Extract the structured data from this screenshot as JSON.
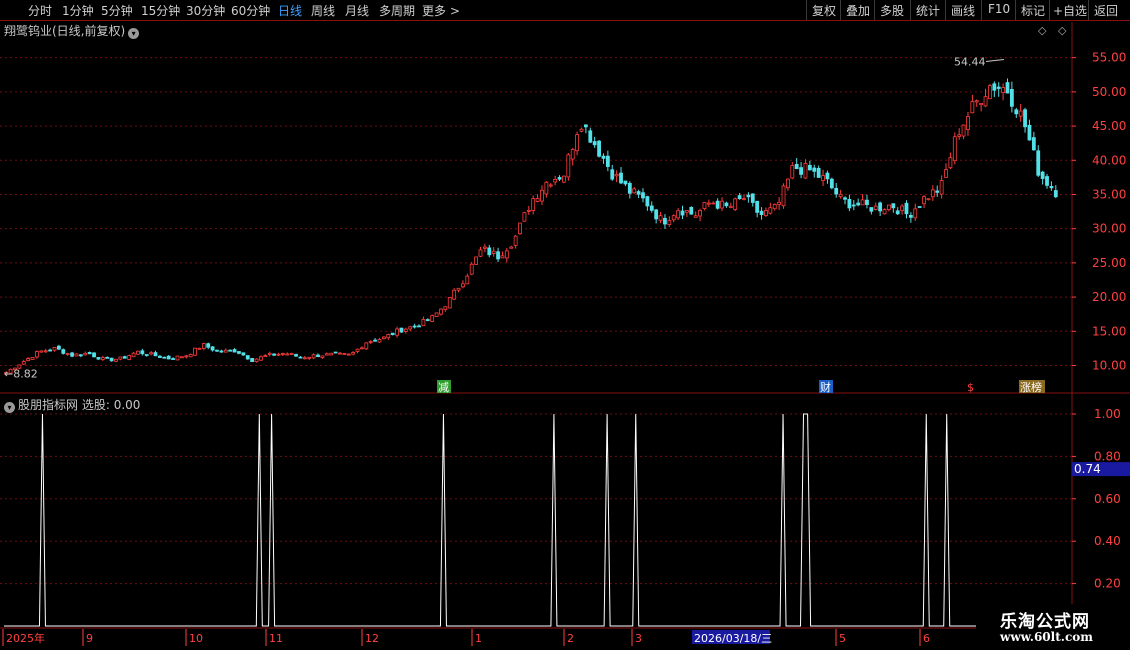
{
  "toolbar": {
    "timeframes": [
      "分时",
      "1分钟",
      "5分钟",
      "15分钟",
      "30分钟",
      "60分钟",
      "日线",
      "周线",
      "月线",
      "多周期",
      "更多"
    ],
    "active": "日线",
    "more_arrow": ">",
    "right_buttons": [
      "复权",
      "叠加",
      "多股",
      "统计",
      "画线",
      "F10",
      "标记",
      "+自选",
      "返回"
    ]
  },
  "main_panel": {
    "title": "翔鹭钨业(日线,前复权)",
    "price_high_label": "54.44",
    "price_low_label": "8.82",
    "event_markers": [
      "减",
      "财",
      "$",
      "涨榜"
    ],
    "y_ticks": [
      "55.00",
      "50.00",
      "45.00",
      "40.00",
      "35.00",
      "30.00",
      "25.00",
      "20.00",
      "15.00",
      "10.00"
    ]
  },
  "indicator_panel": {
    "title": "股朋指标网",
    "label": "选股:",
    "value": "0.00",
    "cursor_value": "0.74",
    "y_ticks": [
      "1.00",
      "0.80",
      "0.60",
      "0.40",
      "0.20"
    ]
  },
  "x_axis": {
    "labels": [
      "2025年",
      "9",
      "10",
      "11",
      "12",
      "1",
      "2",
      "3",
      "2026/03/18/三",
      "5",
      "6"
    ]
  },
  "watermark": {
    "title": "乐淘公式网",
    "url": "www.60lt.com"
  },
  "colors": {
    "up": "#ff3c3c",
    "down": "#54e0e8",
    "grid": "#6e1010",
    "axis_text": "#ff4040",
    "active_tab": "#3fa0ff",
    "highlight": "#1a1aa0"
  },
  "chart_data": [
    {
      "type": "candlestick",
      "title": "翔鹭钨业(日线,前复权)",
      "y_range": [
        7,
        57
      ],
      "x_months": [
        "2025-08",
        "2025-09",
        "2025-10",
        "2025-11",
        "2025-12",
        "2026-01",
        "2026-02",
        "2026-03",
        "2026-04",
        "2026-05",
        "2026-06"
      ],
      "anchors_close": [
        9.0,
        10.5,
        12.0,
        12.5,
        11.5,
        11.8,
        10.8,
        11.0,
        12.0,
        11.5,
        11.0,
        11.5,
        13.0,
        12.0,
        12.2,
        10.8,
        11.5,
        11.8,
        11.2,
        11.5,
        11.6,
        11.5,
        13.5,
        14.0,
        15.2,
        15.8,
        17.0,
        19.5,
        23.0,
        27.0,
        26.0,
        28.5,
        34.0,
        37.0,
        38.0,
        46.0,
        42.0,
        38.0,
        35.5,
        34.0,
        31.0,
        33.0,
        32.0,
        34.0,
        33.0,
        34.5,
        32.0,
        33.0,
        39.0,
        38.5,
        37.0,
        34.0,
        33.5,
        33.0,
        33.5,
        32.0,
        34.5,
        36.0,
        44.0,
        48.0,
        51.0,
        50.5,
        46.0,
        38.0,
        35.5
      ],
      "marked_high": 54.44,
      "marked_low": 8.82
    },
    {
      "type": "line",
      "name": "选股",
      "y_range": [
        0,
        1
      ],
      "signal_indices": [
        [
          5
        ],
        [
          58
        ],
        [
          61
        ],
        [
          103
        ],
        [
          130
        ],
        [
          143
        ],
        [
          150
        ],
        [
          186
        ],
        [
          191,
          192
        ],
        [
          221
        ],
        [
          226
        ]
      ],
      "last_value": 0.0
    }
  ]
}
